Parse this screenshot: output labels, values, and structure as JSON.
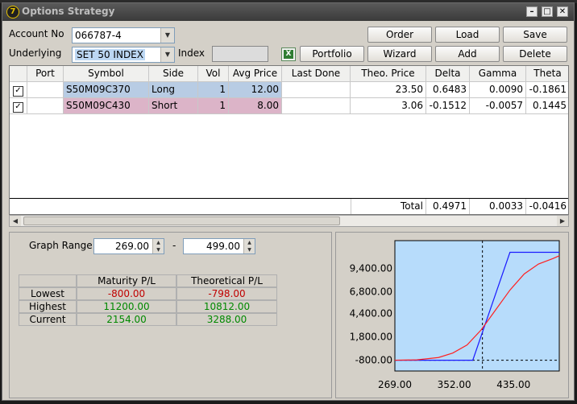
{
  "window": {
    "title": "Options Strategy"
  },
  "form": {
    "account_label": "Account No",
    "account_value": "066787-4",
    "underlying_label": "Underlying",
    "underlying_value": "SET 50 INDEX",
    "index_label": "Index"
  },
  "buttons": {
    "order": "Order",
    "load": "Load",
    "save": "Save",
    "portfolio": "Portfolio",
    "wizard": "Wizard",
    "add": "Add",
    "delete": "Delete"
  },
  "table": {
    "headers": [
      "",
      "Port",
      "Symbol",
      "Side",
      "Vol",
      "Avg Price",
      "Last Done",
      "Theo. Price",
      "Delta",
      "Gamma",
      "Theta"
    ],
    "rows": [
      {
        "checked": "✓",
        "port": "",
        "symbol": "S50M09C370",
        "side": "Long",
        "vol": "1",
        "avg_price": "12.00",
        "last_done": "",
        "theo_price": "23.50",
        "delta": "0.6483",
        "gamma": "0.0090",
        "theta": "-0.1861",
        "row_color": "#b8cce4"
      },
      {
        "checked": "✓",
        "port": "",
        "symbol": "S50M09C430",
        "side": "Short",
        "vol": "1",
        "avg_price": "8.00",
        "last_done": "",
        "theo_price": "3.06",
        "delta": "-0.1512",
        "gamma": "-0.0057",
        "theta": "0.1445",
        "row_color": "#dcb4c8"
      }
    ],
    "total": {
      "label": "Total",
      "delta": "0.4971",
      "gamma": "0.0033",
      "theta": "-0.0416"
    }
  },
  "graph_range": {
    "label": "Graph Range",
    "from": "269.00",
    "separator": "-",
    "to": "499.00"
  },
  "pl_table": {
    "headers": [
      "",
      "Maturity P/L",
      "Theoretical P/L"
    ],
    "rows": [
      {
        "label": "Lowest",
        "maturity": "-800.00",
        "theoretical": "-798.00"
      },
      {
        "label": "Highest",
        "maturity": "11200.00",
        "theoretical": "10812.00"
      },
      {
        "label": "Current",
        "maturity": "2154.00",
        "theoretical": "3288.00"
      }
    ]
  },
  "chart_data": {
    "type": "line",
    "xlim": [
      269,
      499
    ],
    "ylim": [
      -2000,
      12500
    ],
    "x_ticks": [
      "269.00",
      "352.00",
      "435.00"
    ],
    "y_ticks": [
      "9,400.00",
      "6,800.00",
      "4,400.00",
      "1,800.00",
      "-800.00"
    ],
    "current_x": 391.5,
    "current_y": -800,
    "series": [
      {
        "color": "#1a1aff",
        "x": [
          269,
          370,
          378,
          430,
          440,
          499
        ],
        "y": [
          -800,
          -800,
          -800,
          11200,
          11200,
          11200
        ]
      },
      {
        "color": "#ff2020",
        "x": [
          269,
          300,
          330,
          350,
          370,
          390,
          410,
          430,
          450,
          470,
          490,
          499
        ],
        "y": [
          -798,
          -760,
          -500,
          0,
          900,
          2600,
          4800,
          7000,
          8800,
          9900,
          10500,
          10812
        ]
      }
    ],
    "background": "#b7dcfb"
  }
}
